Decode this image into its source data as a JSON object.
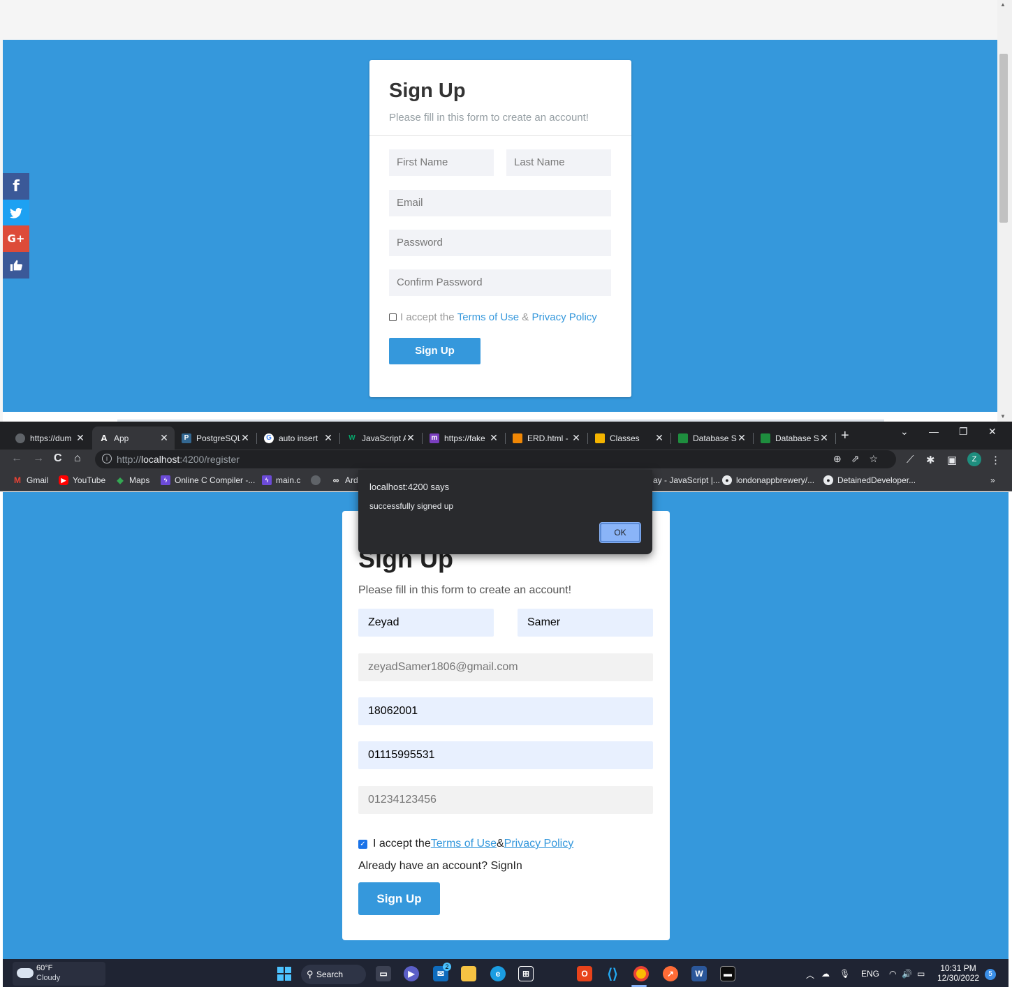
{
  "top_page": {
    "social": {
      "facebook": "f",
      "twitter": "🐦",
      "googleplus": "G+",
      "like": "👍"
    },
    "title": "Sign Up",
    "subtitle": "Please fill in this form to create an account!",
    "first_name_placeholder": "First Name",
    "last_name_placeholder": "Last Name",
    "email_placeholder": "Email",
    "password_placeholder": "Password",
    "confirm_password_placeholder": "Confirm Password",
    "accept_prefix": "I accept the",
    "terms_link": "Terms of Use",
    "amp": "&",
    "privacy_link": "Privacy Policy",
    "signup_button": "Sign Up"
  },
  "browser": {
    "tabs": [
      {
        "icon": "globe-icon",
        "glyph": "●",
        "color": "#5f6368",
        "label": "https://dum"
      },
      {
        "icon": "angular-icon",
        "glyph": "A",
        "color": "#35363a",
        "label": "App",
        "active": true
      },
      {
        "icon": "postgres-icon",
        "glyph": "🐘",
        "color": "#336791",
        "label": "PostgreSQL"
      },
      {
        "icon": "google-icon",
        "glyph": "G",
        "color": "#ffffff",
        "label": "auto insert"
      },
      {
        "icon": "w3-icon",
        "glyph": "W",
        "color": "#04aa6d",
        "label": "JavaScript A"
      },
      {
        "icon": "mockaroo-icon",
        "glyph": "m",
        "color": "#7b3fbf",
        "label": "https://fake"
      },
      {
        "icon": "drawio-icon",
        "glyph": "■",
        "color": "#f08705",
        "label": "ERD.html -"
      },
      {
        "icon": "classroom-icon",
        "glyph": "▣",
        "color": "#f4b400",
        "label": "Classes"
      },
      {
        "icon": "classroom-icon",
        "glyph": "▣",
        "color": "#1e8e3e",
        "label": "Database S"
      },
      {
        "icon": "classroom-icon",
        "glyph": "▣",
        "color": "#1e8e3e",
        "label": "Database S"
      }
    ],
    "new_tab": "+",
    "url_host": "http://",
    "url_domain": "localhost",
    "url_rest": ":4200/register",
    "avatar_letter": "Z",
    "bookmarks": [
      {
        "icon": "gmail-icon",
        "glyph": "M",
        "color": "#ea4335",
        "label": "Gmail"
      },
      {
        "icon": "youtube-icon",
        "glyph": "▶",
        "color": "#ff0000",
        "label": "YouTube"
      },
      {
        "icon": "maps-icon",
        "glyph": "◆",
        "color": "#34a853",
        "label": "Maps"
      },
      {
        "icon": "replit-icon",
        "glyph": "⚡",
        "color": "#6c4bd8",
        "label": "Online C Compiler -..."
      },
      {
        "icon": "replit-icon",
        "glyph": "⚡",
        "color": "#6c4bd8",
        "label": "main.c"
      },
      {
        "icon": "globe-icon",
        "glyph": "●",
        "color": "#5f6368",
        "label": ""
      },
      {
        "icon": "infinity-icon",
        "glyph": "∞",
        "color": "#35363a",
        "label": "Ard"
      }
    ],
    "bookmarks_right": [
      {
        "label": "ay - JavaScript |..."
      },
      {
        "icon": "github-icon",
        "label": "londonappbrewery/..."
      },
      {
        "icon": "github-icon",
        "label": "DetainedDeveloper..."
      }
    ],
    "overflow": "»"
  },
  "dialog": {
    "title": "localhost:4200 says",
    "message": "successfully signed up",
    "ok": "OK"
  },
  "form": {
    "title": "Sign Up",
    "subtitle": "Please fill in this form to create an account!",
    "first_name": "Zeyad",
    "last_name": "Samer",
    "email_placeholder": "zeyadSamer1806@gmail.com",
    "password": "18062001",
    "phone": "01115995531",
    "phone2_placeholder": "01234123456",
    "accept_prefix": "I accept the",
    "terms_link": "Terms of Use",
    "amp": "&",
    "privacy_link": "Privacy Policy",
    "already": "Already have an account? SignIn",
    "signup_button": "Sign Up"
  },
  "taskbar": {
    "temp": "60°F",
    "condition": "Cloudy",
    "search": "Search",
    "lang": "ENG",
    "time": "10:31 PM",
    "date": "12/30/2022",
    "notif": "5",
    "mail_badge": "2"
  }
}
